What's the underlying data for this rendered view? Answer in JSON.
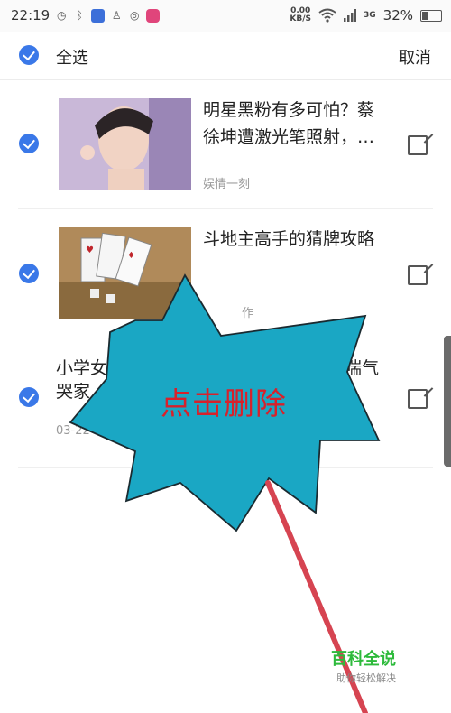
{
  "status_bar": {
    "time": "22:19",
    "speed_value": "0.00",
    "speed_unit": "KB/S",
    "network": "3G",
    "battery": "32%",
    "battery_level": 0.32,
    "icons": [
      "alarm-icon",
      "bluetooth-icon",
      "shield-app-icon",
      "qq-icon",
      "app-swirl-icon",
      "pink-app-icon",
      "wifi-icon",
      "signal-icon",
      "signal-3g-icon",
      "battery-icon"
    ]
  },
  "toolbar": {
    "select_all": "全选",
    "cancel": "取消"
  },
  "articles": [
    {
      "title_line1": "明星黑粉有多可怕？蔡",
      "title_line2": "徐坤遭激光笔照射，…",
      "source": "娱情一刻"
    },
    {
      "title_line1": "斗地主高手的猜牌攻略",
      "title_line2": "",
      "source": "作"
    },
    {
      "title_line1": "小学女",
      "title_line1_right": "喘气",
      "title_line2": "哭家",
      "date": "03-22"
    }
  ],
  "overlay": {
    "label": "点击删除",
    "fill_color": "#1aa7c4",
    "arrow_color": "#d64451"
  },
  "watermark": {
    "title": "百科全说",
    "subtitle": "助你轻松解决"
  }
}
